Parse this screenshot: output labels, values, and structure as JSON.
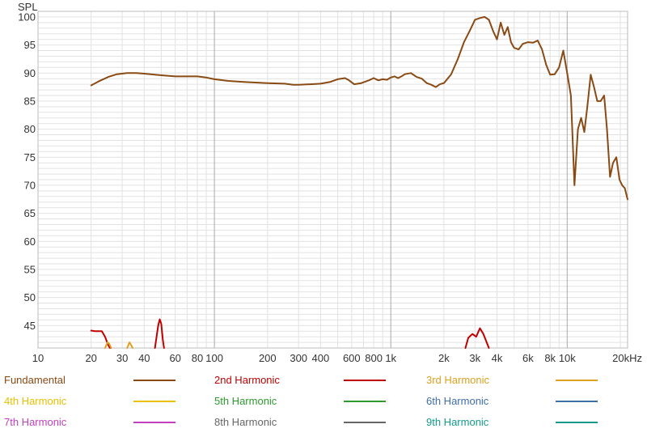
{
  "chart_data": {
    "type": "line",
    "title": "",
    "xlabel": "",
    "ylabel": "SPL",
    "x_scale": "log",
    "xlim": [
      10,
      22000
    ],
    "ylim": [
      41,
      101
    ],
    "grid": true,
    "legend_position": "bottom",
    "x_ticks": [
      {
        "value": 10,
        "label": "10"
      },
      {
        "value": 20,
        "label": "20"
      },
      {
        "value": 30,
        "label": "30"
      },
      {
        "value": 40,
        "label": "40"
      },
      {
        "value": 60,
        "label": "60"
      },
      {
        "value": 80,
        "label": "80"
      },
      {
        "value": 100,
        "label": "100"
      },
      {
        "value": 200,
        "label": "200"
      },
      {
        "value": 300,
        "label": "300"
      },
      {
        "value": 400,
        "label": "400"
      },
      {
        "value": 600,
        "label": "600"
      },
      {
        "value": 800,
        "label": "800"
      },
      {
        "value": 1000,
        "label": "1k"
      },
      {
        "value": 2000,
        "label": "2k"
      },
      {
        "value": 3000,
        "label": "3k"
      },
      {
        "value": 4000,
        "label": "4k"
      },
      {
        "value": 6000,
        "label": "6k"
      },
      {
        "value": 8000,
        "label": "8k"
      },
      {
        "value": 10000,
        "label": "10k"
      },
      {
        "value": 20000,
        "label": "20kHz"
      }
    ],
    "y_ticks": [
      {
        "value": 45,
        "label": "45"
      },
      {
        "value": 50,
        "label": "50"
      },
      {
        "value": 55,
        "label": "55"
      },
      {
        "value": 60,
        "label": "60"
      },
      {
        "value": 65,
        "label": "65"
      },
      {
        "value": 70,
        "label": "70"
      },
      {
        "value": 75,
        "label": "75"
      },
      {
        "value": 80,
        "label": "80"
      },
      {
        "value": 85,
        "label": "85"
      },
      {
        "value": 90,
        "label": "90"
      },
      {
        "value": 95,
        "label": "95"
      },
      {
        "value": 100,
        "label": "100"
      }
    ],
    "series": [
      {
        "name": "Fundamental",
        "color": "#8a4a14",
        "points": [
          [
            20,
            87.8
          ],
          [
            22,
            88.5
          ],
          [
            25,
            89.3
          ],
          [
            28,
            89.8
          ],
          [
            32,
            90.0
          ],
          [
            36,
            90.0
          ],
          [
            40,
            89.9
          ],
          [
            50,
            89.6
          ],
          [
            60,
            89.4
          ],
          [
            70,
            89.4
          ],
          [
            80,
            89.4
          ],
          [
            90,
            89.2
          ],
          [
            100,
            88.9
          ],
          [
            120,
            88.6
          ],
          [
            150,
            88.4
          ],
          [
            200,
            88.2
          ],
          [
            250,
            88.1
          ],
          [
            280,
            87.9
          ],
          [
            300,
            87.9
          ],
          [
            350,
            88.0
          ],
          [
            400,
            88.1
          ],
          [
            450,
            88.4
          ],
          [
            500,
            88.9
          ],
          [
            550,
            89.1
          ],
          [
            580,
            88.7
          ],
          [
            620,
            88.0
          ],
          [
            680,
            88.2
          ],
          [
            750,
            88.7
          ],
          [
            800,
            89.1
          ],
          [
            850,
            88.7
          ],
          [
            900,
            88.9
          ],
          [
            950,
            88.8
          ],
          [
            1000,
            89.2
          ],
          [
            1050,
            89.4
          ],
          [
            1100,
            89.1
          ],
          [
            1150,
            89.4
          ],
          [
            1200,
            89.8
          ],
          [
            1300,
            90.0
          ],
          [
            1400,
            89.3
          ],
          [
            1500,
            89.0
          ],
          [
            1600,
            88.2
          ],
          [
            1700,
            87.9
          ],
          [
            1800,
            87.5
          ],
          [
            1900,
            88.0
          ],
          [
            2000,
            88.2
          ],
          [
            2200,
            89.8
          ],
          [
            2400,
            92.5
          ],
          [
            2600,
            95.5
          ],
          [
            2800,
            97.5
          ],
          [
            3000,
            99.5
          ],
          [
            3200,
            99.8
          ],
          [
            3400,
            100.0
          ],
          [
            3600,
            99.5
          ],
          [
            3800,
            97.5
          ],
          [
            4000,
            96.0
          ],
          [
            4200,
            99.0
          ],
          [
            4400,
            96.8
          ],
          [
            4600,
            98.2
          ],
          [
            4800,
            95.5
          ],
          [
            5000,
            94.5
          ],
          [
            5300,
            94.2
          ],
          [
            5600,
            95.2
          ],
          [
            6000,
            95.5
          ],
          [
            6400,
            95.4
          ],
          [
            6800,
            95.8
          ],
          [
            7200,
            94.2
          ],
          [
            7600,
            91.5
          ],
          [
            8000,
            89.7
          ],
          [
            8500,
            89.8
          ],
          [
            9000,
            91.0
          ],
          [
            9500,
            94.0
          ],
          [
            10000,
            90.0
          ],
          [
            10500,
            86.0
          ],
          [
            11000,
            70.0
          ],
          [
            11500,
            80.0
          ],
          [
            12000,
            82.0
          ],
          [
            12500,
            79.5
          ],
          [
            13000,
            84.0
          ],
          [
            13600,
            89.7
          ],
          [
            14200,
            87.5
          ],
          [
            14800,
            85.0
          ],
          [
            15500,
            85.0
          ],
          [
            16200,
            86.0
          ],
          [
            16800,
            80.0
          ],
          [
            17500,
            71.5
          ],
          [
            18200,
            74.0
          ],
          [
            19000,
            75.0
          ],
          [
            19800,
            71.0
          ],
          [
            20500,
            70.0
          ],
          [
            21200,
            69.5
          ],
          [
            22000,
            67.5
          ]
        ]
      },
      {
        "name": "2nd Harmonic",
        "color": "#c00000",
        "segments": [
          [
            [
              20,
              44.1
            ],
            [
              21,
              44.0
            ],
            [
              23,
              44.0
            ],
            [
              24,
              43.0
            ],
            [
              25,
              41.5
            ],
            [
              25.6,
              41.0
            ]
          ],
          [
            [
              46,
              41.0
            ],
            [
              47,
              43.0
            ],
            [
              48,
              45.0
            ],
            [
              49,
              46.1
            ],
            [
              50,
              45.3
            ],
            [
              51,
              42.5
            ],
            [
              51.8,
              41.0
            ]
          ],
          [
            [
              2650,
              41.0
            ],
            [
              2750,
              42.8
            ],
            [
              2900,
              43.5
            ],
            [
              3050,
              43.0
            ],
            [
              3200,
              44.5
            ],
            [
              3350,
              43.5
            ],
            [
              3600,
              41.0
            ]
          ]
        ]
      },
      {
        "name": "3rd Harmonic",
        "color": "#e0a020",
        "segments": [
          [
            [
              24,
              41.0
            ],
            [
              24.8,
              42.0
            ],
            [
              25.3,
              41.8
            ],
            [
              26,
              41.0
            ]
          ],
          [
            [
              32,
              41.0
            ],
            [
              33,
              42.0
            ],
            [
              33.6,
              41.6
            ],
            [
              34.4,
              41.0
            ]
          ]
        ]
      },
      {
        "name": "4th Harmonic",
        "color": "#e8c000"
      },
      {
        "name": "5th Harmonic",
        "color": "#2e9a2e"
      },
      {
        "name": "6th Harmonic",
        "color": "#3f6ea8"
      },
      {
        "name": "7th Harmonic",
        "color": "#c040c0"
      },
      {
        "name": "8th Harmonic",
        "color": "#666666"
      },
      {
        "name": "9th Harmonic",
        "color": "#149a8a"
      }
    ]
  }
}
